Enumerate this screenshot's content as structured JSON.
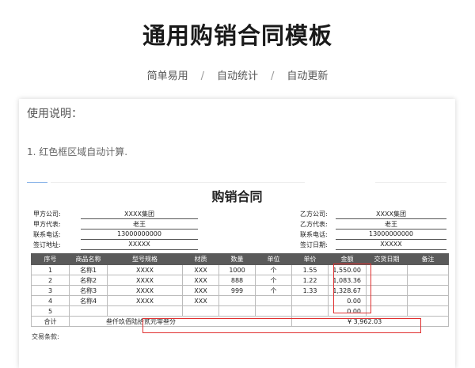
{
  "hero": {
    "title": "通用购销合同模板",
    "tags": [
      "简单易用",
      "自动统计",
      "自动更新"
    ],
    "separator": "/"
  },
  "instructions": {
    "title": "使用说明：",
    "line1": "1. 红色框区域自动计算."
  },
  "contract": {
    "title": "购销合同",
    "party_a": [
      {
        "label": "甲方公司:",
        "value": "XXXX集团"
      },
      {
        "label": "甲方代表:",
        "value": "老王"
      },
      {
        "label": "联系电话:",
        "value": "13000000000"
      },
      {
        "label": "签订地址:",
        "value": "XXXXX"
      }
    ],
    "party_b": [
      {
        "label": "乙方公司:",
        "value": "XXXX集团"
      },
      {
        "label": "乙方代表:",
        "value": "老王"
      },
      {
        "label": "联系电话:",
        "value": "13000000000"
      },
      {
        "label": "签订日期:",
        "value": "XXXXX"
      }
    ],
    "table": {
      "headers": [
        "序号",
        "商品名称",
        "型号规格",
        "材质",
        "数量",
        "单位",
        "单价",
        "金额",
        "交货日期",
        "备注"
      ],
      "rows": [
        [
          "1",
          "名称1",
          "XXXX",
          "XXX",
          "1000",
          "个",
          "1.55",
          "1,550.00",
          "",
          ""
        ],
        [
          "2",
          "名称2",
          "XXXX",
          "XXX",
          "888",
          "个",
          "1.22",
          "1,083.36",
          "",
          ""
        ],
        [
          "3",
          "名称3",
          "XXXX",
          "XXX",
          "999",
          "个",
          "1.33",
          "1,328.67",
          "",
          ""
        ],
        [
          "4",
          "名称4",
          "XXXX",
          "XXX",
          "",
          "",
          "",
          "0.00",
          "",
          ""
        ],
        [
          "5",
          "",
          "",
          "",
          "",
          "",
          "",
          "0.00",
          "",
          ""
        ]
      ],
      "total_label": "合计",
      "total_in_words": "叁仟玖佰陆拾贰元零叁分",
      "total_amount": "¥ 3,962.03"
    },
    "footer_partial": "交易条款:"
  },
  "colors": {
    "header_bg": "#5a5a5a",
    "highlight": "#e03030"
  }
}
